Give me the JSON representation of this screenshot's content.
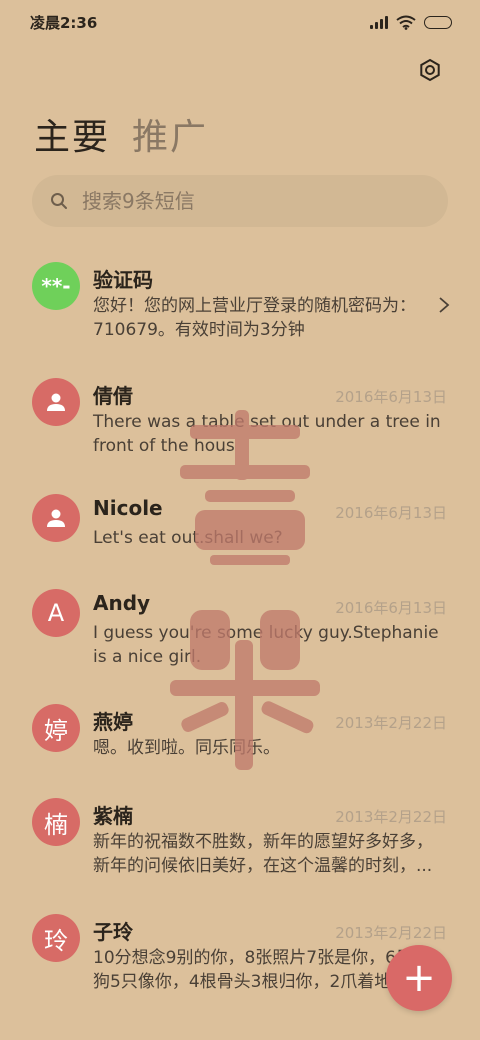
{
  "status_bar": {
    "time": "凌晨2:36"
  },
  "tabs": [
    {
      "label": "主要"
    },
    {
      "label": "推广"
    }
  ],
  "search": {
    "placeholder": "搜索9条短信"
  },
  "colors": {
    "background": "#dcc09b",
    "avatar_red": "#d76b66",
    "avatar_green": "#6fd05a",
    "fab": "#d96967"
  },
  "messages": [
    {
      "avatar": "**-",
      "avatar_icon": "",
      "name": "验证码",
      "date": "",
      "preview": "您好！您的网上营业厅登录的随机密码为：710679。有效时间为3分钟"
    },
    {
      "avatar": "",
      "avatar_icon": "person-icon",
      "name": "倩倩",
      "date": "2016年6月13日",
      "preview": "There was a table set out under a tree in front of the hous"
    },
    {
      "avatar": "",
      "avatar_icon": "person-icon",
      "name": "Nicole",
      "date": "2016年6月13日",
      "preview": "Let's eat out.shall we?"
    },
    {
      "avatar": "A",
      "avatar_icon": "",
      "name": "Andy",
      "date": "2016年6月13日",
      "preview": "I guess you're some lucky guy.Stephanie is a nice girl."
    },
    {
      "avatar": "婷",
      "avatar_icon": "",
      "name": "燕婷",
      "date": "2013年2月22日",
      "preview": "嗯。收到啦。同乐同乐。"
    },
    {
      "avatar": "楠",
      "avatar_icon": "",
      "name": "紫楠",
      "date": "2013年2月22日",
      "preview": "新年的祝福数不胜数，新年的愿望好多好多，新年的问候依旧美好，在这个温馨的时刻，..."
    },
    {
      "avatar": "玲",
      "avatar_icon": "",
      "name": "子玲",
      "date": "2013年2月22日",
      "preview": "10分想念9别的你，8张照片7张是你，6只小狗5只像你，4根骨头3根归你，2爪着地"
    }
  ],
  "fab": {
    "label": "+"
  }
}
